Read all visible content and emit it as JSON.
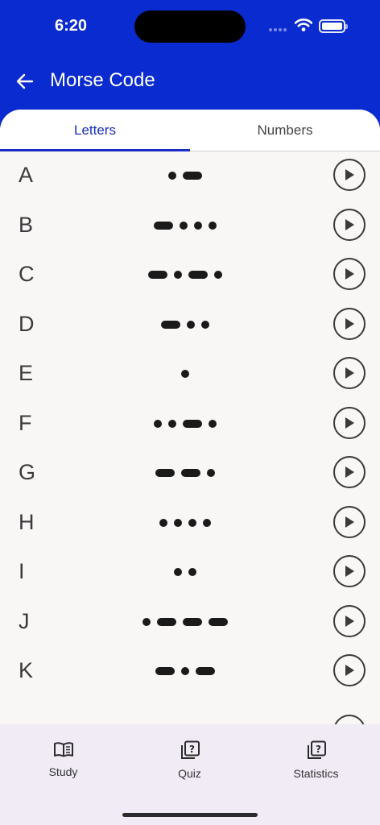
{
  "status": {
    "time": "6:20"
  },
  "header": {
    "title": "Morse Code"
  },
  "tabs": [
    {
      "label": "Letters",
      "active": true
    },
    {
      "label": "Numbers",
      "active": false
    }
  ],
  "letters": [
    {
      "char": "A",
      "code": ".-"
    },
    {
      "char": "B",
      "code": "-..."
    },
    {
      "char": "C",
      "code": "-.-."
    },
    {
      "char": "D",
      "code": "-.."
    },
    {
      "char": "E",
      "code": "."
    },
    {
      "char": "F",
      "code": "..-."
    },
    {
      "char": "G",
      "code": "--."
    },
    {
      "char": "H",
      "code": "...."
    },
    {
      "char": "I",
      "code": ".."
    },
    {
      "char": "J",
      "code": ".---"
    },
    {
      "char": "K",
      "code": "-.-"
    }
  ],
  "bottom_nav": [
    {
      "label": "Study",
      "icon": "book-icon"
    },
    {
      "label": "Quiz",
      "icon": "quiz-icon"
    },
    {
      "label": "Statistics",
      "icon": "statistics-icon"
    }
  ],
  "colors": {
    "primary": "#0a2bd0",
    "accent": "#1a2cc4",
    "sheet": "#f9f6f6",
    "nav": "#f1ebf6"
  }
}
